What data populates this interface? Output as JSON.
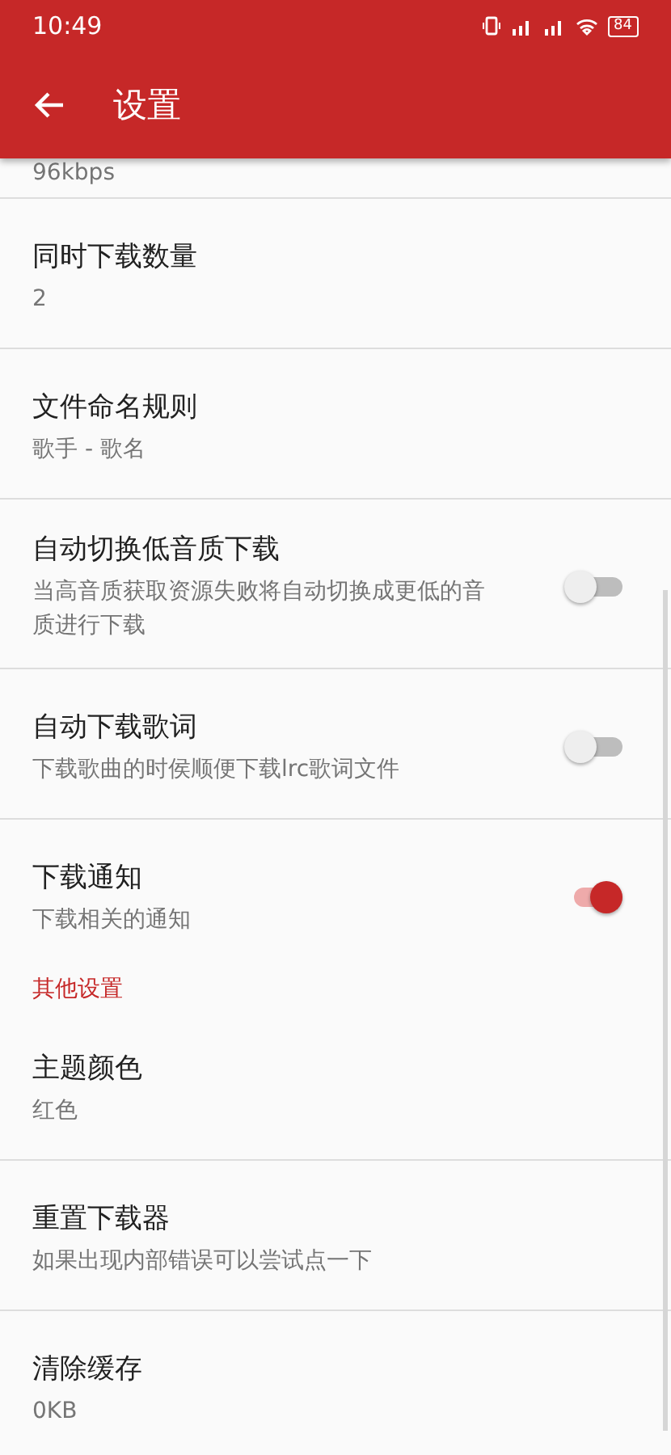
{
  "status_bar": {
    "time": "10:49",
    "battery": "84"
  },
  "app_bar": {
    "title": "设置"
  },
  "items": [
    {
      "kind": "cut",
      "subtitle": "96kbps"
    },
    {
      "kind": "value",
      "title": "同时下载数量",
      "subtitle": "2"
    },
    {
      "kind": "value",
      "title": "文件命名规则",
      "subtitle": "歌手 - 歌名"
    },
    {
      "kind": "switch",
      "title": "自动切换低音质下载",
      "subtitle": "当高音质获取资源失败将自动切换成更低的音质进行下载",
      "on": false
    },
    {
      "kind": "switch",
      "title": "自动下载歌词",
      "subtitle": "下载歌曲的时侯顺便下载lrc歌词文件",
      "on": false
    },
    {
      "kind": "switch",
      "title": "下载通知",
      "subtitle": "下载相关的通知",
      "on": true
    },
    {
      "kind": "header",
      "title": "其他设置"
    },
    {
      "kind": "value",
      "title": "主题颜色",
      "subtitle": "红色"
    },
    {
      "kind": "value",
      "title": "重置下载器",
      "subtitle": "如果出现内部错误可以尝试点一下"
    },
    {
      "kind": "value",
      "title": "清除缓存",
      "subtitle": "0KB"
    }
  ]
}
